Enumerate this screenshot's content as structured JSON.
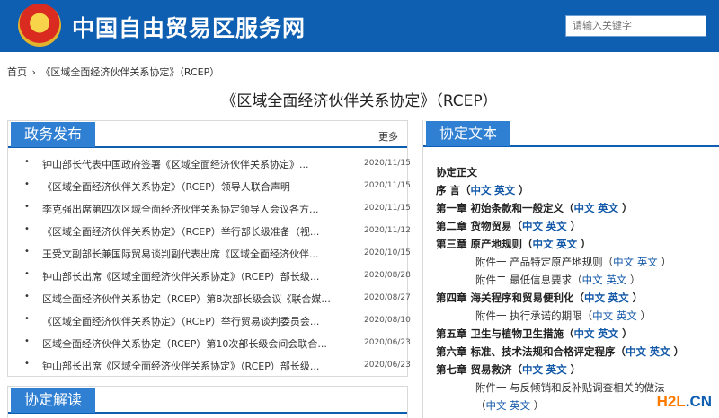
{
  "header": {
    "title": "中国自由贸易区服务网",
    "search_placeholder": "请输入关键字"
  },
  "breadcrumb": {
    "home": "首页",
    "sep": "›",
    "current": "《区域全面经济伙伴关系协定》（RCEP）"
  },
  "page_title": "《区域全面经济伙伴关系协定》（RCEP）",
  "news_panel": {
    "title": "政务发布",
    "more": "更多",
    "items": [
      {
        "text": "钟山部长代表中国政府签署《区域全面经济伙伴关系协定》...",
        "date": "2020/11/15"
      },
      {
        "text": "《区域全面经济伙伴关系协定》（RCEP）领导人联合声明",
        "date": "2020/11/15"
      },
      {
        "text": "李克强出席第四次区域全面经济伙伴关系协定领导人会议各方...",
        "date": "2020/11/15"
      },
      {
        "text": "《区域全面经济伙伴关系协定》（RCEP）举行部长级准备（视...",
        "date": "2020/11/12"
      },
      {
        "text": "王受文副部长兼国际贸易谈判副代表出席《区域全面经济伙伴...",
        "date": "2020/10/15"
      },
      {
        "text": "钟山部长出席《区域全面经济伙伴关系协定》（RCEP）部长级...",
        "date": "2020/08/28"
      },
      {
        "text": "区域全面经济伙伴关系协定（RCEP）第8次部长级会议《联合媒...",
        "date": "2020/08/27"
      },
      {
        "text": "《区域全面经济伙伴关系协定》（RCEP）举行贸易谈判委员会...",
        "date": "2020/08/10"
      },
      {
        "text": "区域全面经济伙伴关系协定（RCEP）第10次部长级会间会联合...",
        "date": "2020/06/23"
      },
      {
        "text": "钟山部长出席《区域全面经济伙伴关系协定》（RCEP）部长级...",
        "date": "2020/06/23"
      }
    ]
  },
  "interp_panel": {
    "title": "协定解读"
  },
  "text_panel": {
    "title": "协定文本",
    "heading": "协定正文",
    "zh": "中文",
    "en": "英文",
    "rows": [
      {
        "label": "序 言（",
        "sub": false
      },
      {
        "label": "第一章  初始条款和一般定义（",
        "sub": false
      },
      {
        "label": "第二章  货物贸易（",
        "sub": false
      },
      {
        "label": "第三章  原产地规则（",
        "sub": false
      },
      {
        "label": "附件一  产品特定原产地规则（",
        "sub": true
      },
      {
        "label": "附件二  最低信息要求（",
        "sub": true
      },
      {
        "label": "第四章  海关程序和贸易便利化（",
        "sub": false
      },
      {
        "label": "附件一  执行承诺的期限（",
        "sub": true
      },
      {
        "label": "第五章  卫生与植物卫生措施（",
        "sub": false
      },
      {
        "label": "第六章  标准、技术法规和合格评定程序（",
        "sub": false
      },
      {
        "label": "第七章  贸易救济（",
        "sub": false
      },
      {
        "label": "附件一  与反倾销和反补贴调查相关的做法",
        "sub": true,
        "nolinks": true
      },
      {
        "label": "（",
        "sub": true
      }
    ]
  },
  "watermark": {
    "a": "H2L",
    "b": ".CN"
  }
}
